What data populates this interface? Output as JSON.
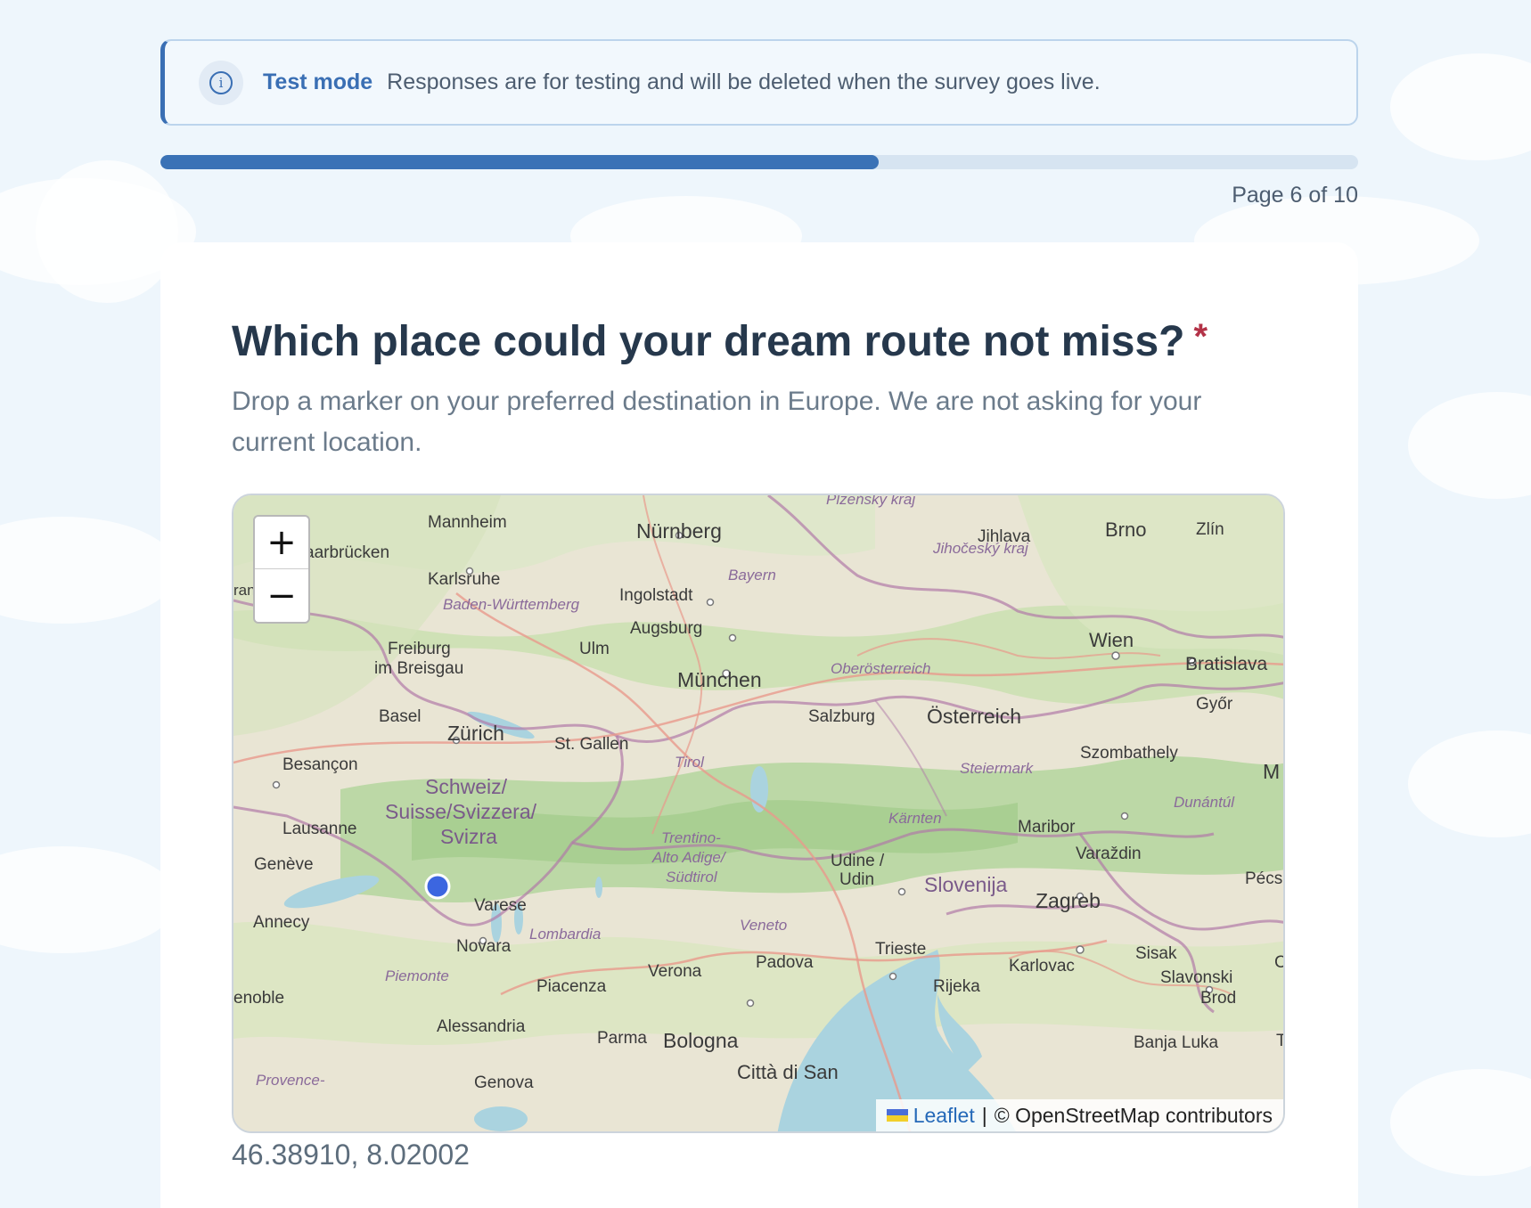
{
  "notice": {
    "icon": "info-icon",
    "title": "Test mode",
    "text": "Responses are for testing and will be deleted when the survey goes live."
  },
  "progress": {
    "fraction": 0.6,
    "label": "Page 6 of 10",
    "color": "#3a72b6"
  },
  "question": {
    "title": "Which place could your dream route not miss?",
    "required_mark": "*",
    "description": "Drop a marker on your preferred destination in Europe. We are not asking for your current location."
  },
  "map": {
    "zoom_in_label": "+",
    "zoom_out_label": "−",
    "attribution_link": "Leaflet",
    "attribution_separator": "|",
    "attribution_text": "© OpenStreetMap contributors",
    "marker": {
      "lat": 46.3891,
      "lng": 8.02002,
      "color": "#3c66e0"
    },
    "labels": {
      "mannheim": "Mannheim",
      "nurnberg": "Nürnberg",
      "plzensky": "Plzeňský kraj",
      "jihocesky": "Jihočeský kraj",
      "jihlava": "Jihlava",
      "brno": "Brno",
      "zlin": "Zlín",
      "saarbrucken": "aarbrücken",
      "karlsruhe": "Karlsruhe",
      "bw": "Baden-Württemberg",
      "ingolstadt": "Ingolstadt",
      "bayern": "Bayern",
      "augsburg": "Augsburg",
      "freiburg1": "Freiburg",
      "freiburg2": "im Breisgau",
      "ulm": "Ulm",
      "munchen": "München",
      "oberosterreich": "Oberösterreich",
      "wien": "Wien",
      "bratislava": "Bratislava",
      "basel": "Basel",
      "zurich": "Zürich",
      "stgallen": "St. Gallen",
      "salzburg": "Salzburg",
      "osterreich": "Österreich",
      "gyor": "Győr",
      "besancon": "Besançon",
      "tirol": "Tirol",
      "steiermark": "Steiermark",
      "szombathely": "Szombathely",
      "schweiz1": "Schweiz/",
      "schweiz2": "Suisse/Svizzera/",
      "schweiz3": "Svizra",
      "lausanne": "Lausanne",
      "karnten": "Kärnten",
      "dunantul": "Dunántúl",
      "maribor": "Maribor",
      "geneve": "Genève",
      "trentino1": "Trentino-",
      "trentino2": "Alto Adige/",
      "trentino3": "Südtirol",
      "udine1": "Udine /",
      "udine2": "Udin",
      "slovenija": "Slovenija",
      "varazdin": "Varaždin",
      "zagreb": "Zagreb",
      "pecs": "Pécs",
      "varese": "Varese",
      "annecy": "Annecy",
      "lombardia": "Lombardia",
      "veneto": "Veneto",
      "novara": "Novara",
      "trieste": "Trieste",
      "padova": "Padova",
      "verona": "Verona",
      "karlovac": "Karlovac",
      "sisak": "Sisak",
      "piemonte": "Piemonte",
      "piacenza": "Piacenza",
      "rijeka": "Rijeka",
      "slavonski1": "Slavonski",
      "slavonski2": "Brod",
      "grenoble": "enoble",
      "alessandria": "Alessandria",
      "parma": "Parma",
      "bologna": "Bologna",
      "banjaluka": "Banja Luka",
      "citta": "Città di San",
      "provence": "Provence-",
      "genova": "Genova",
      "ma": "M",
      "ran": "ran",
      "ce": "C",
      "te": "T"
    }
  },
  "coordinates": "46.38910, 8.02002"
}
